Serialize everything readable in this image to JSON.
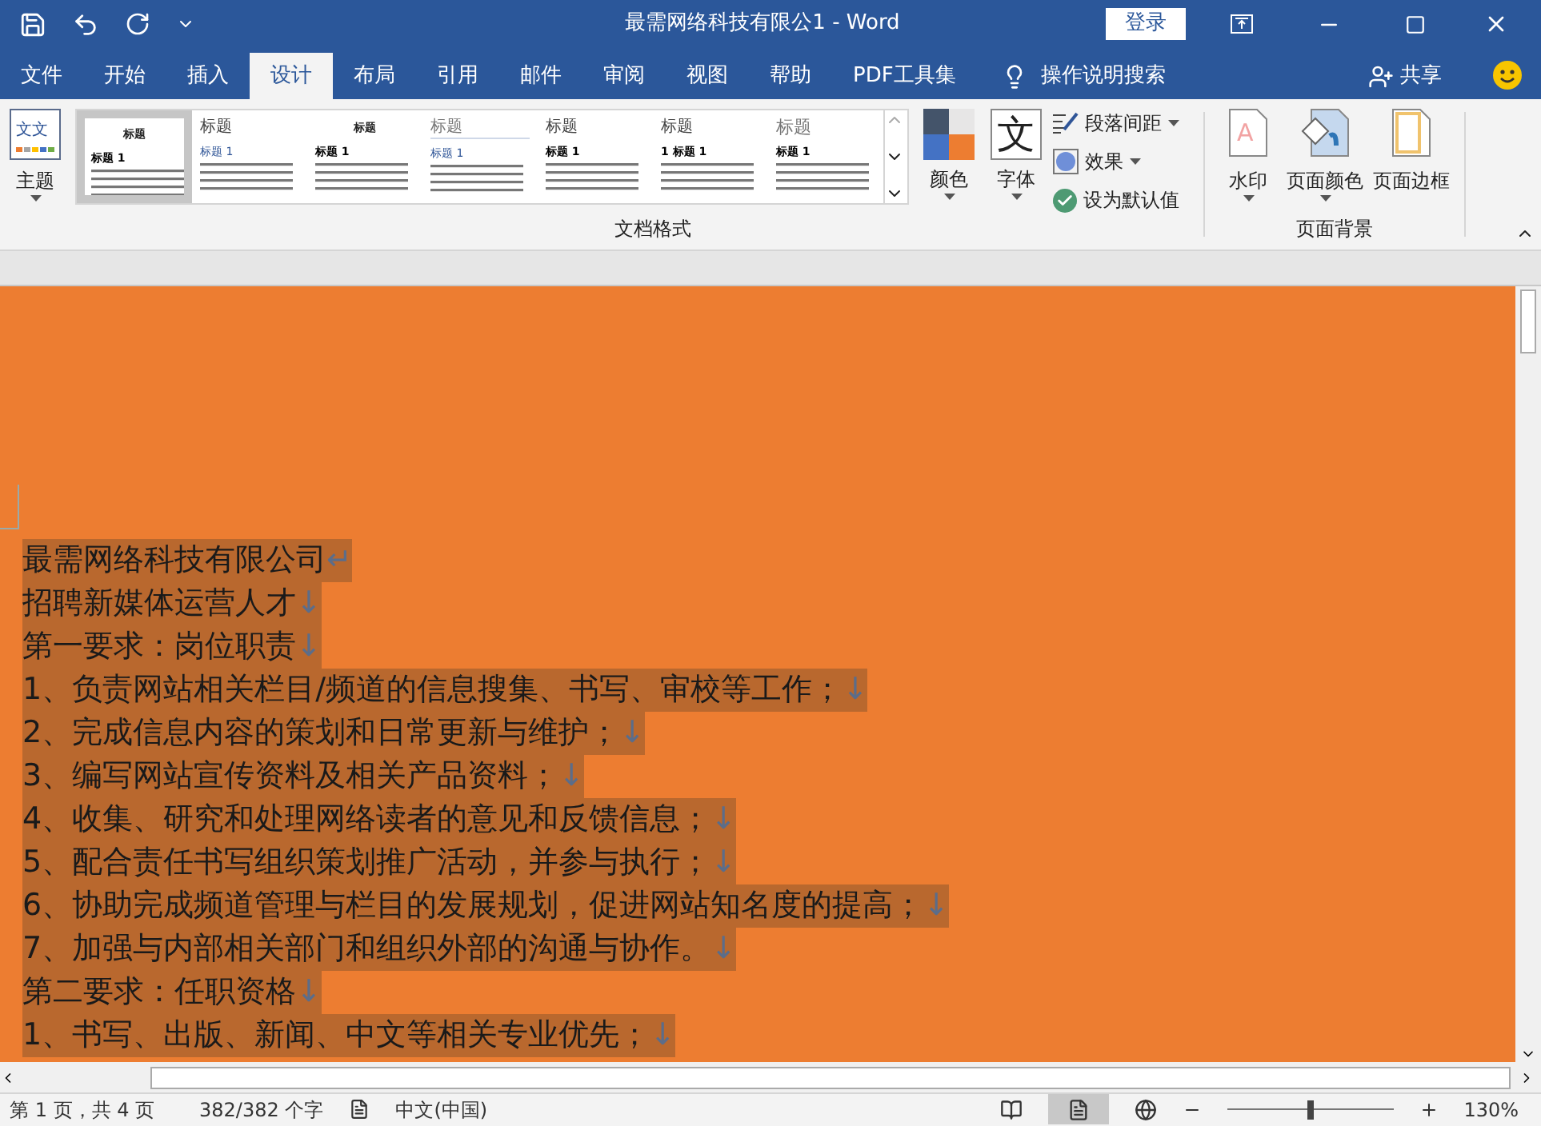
{
  "title_bar": {
    "title": "最需网络科技有限公1  -  Word",
    "login": "登录"
  },
  "tabs": [
    {
      "label": "文件",
      "selected": false
    },
    {
      "label": "开始",
      "selected": false
    },
    {
      "label": "插入",
      "selected": false
    },
    {
      "label": "设计",
      "selected": true
    },
    {
      "label": "布局",
      "selected": false
    },
    {
      "label": "引用",
      "selected": false
    },
    {
      "label": "邮件",
      "selected": false
    },
    {
      "label": "审阅",
      "selected": false
    },
    {
      "label": "视图",
      "selected": false
    },
    {
      "label": "帮助",
      "selected": false
    },
    {
      "label": "PDF工具集",
      "selected": false
    }
  ],
  "tell_me": "操作说明搜索",
  "share": "共享",
  "ribbon": {
    "theme": "主题",
    "theme_glyph": "文文",
    "watermark_glyph": "A",
    "gallery": [
      {
        "title": "标题",
        "heading": "标题 1",
        "selected": true,
        "kind": "centered"
      },
      {
        "title": "标题",
        "heading": "标题 1",
        "selected": false,
        "kind": "blue"
      },
      {
        "title": "标题",
        "heading": "标题 1",
        "selected": false,
        "kind": "centered"
      },
      {
        "title": "标题",
        "heading": "标题 1",
        "selected": false,
        "kind": "lined"
      },
      {
        "title": "标题",
        "heading": "标题 1",
        "selected": false,
        "kind": "plain"
      },
      {
        "title": "标题",
        "heading": "1  标题 1",
        "selected": false,
        "kind": "plain"
      },
      {
        "title": "标题",
        "heading": "标题 1",
        "selected": false,
        "kind": "grey"
      }
    ],
    "colors": "颜色",
    "fonts": "字体",
    "font_glyph": "文",
    "paragraph_spacing": "段落间距",
    "effects": "效果",
    "set_default": "设为默认值",
    "group_format": "文档格式",
    "watermark": "水印",
    "page_color": "页面颜色",
    "page_borders": "页面边框",
    "group_background": "页面背景"
  },
  "document": {
    "selected": true,
    "paragraphs": [
      {
        "text": "最需网络科技有限公司",
        "mark": "↵"
      },
      {
        "text": "招聘新媒体运营人才",
        "mark": "↓"
      },
      {
        "text": "第一要求：岗位职责",
        "mark": "↓"
      },
      {
        "text": "1、负责网站相关栏目/频道的信息搜集、书写、审校等工作；",
        "mark": "↓"
      },
      {
        "text": "2、完成信息内容的策划和日常更新与维护；",
        "mark": "↓"
      },
      {
        "text": "3、编写网站宣传资料及相关产品资料；",
        "mark": "↓"
      },
      {
        "text": "4、收集、研究和处理网络读者的意见和反馈信息；",
        "mark": "↓"
      },
      {
        "text": "5、配合责任书写组织策划推广活动，并参与执行；",
        "mark": "↓"
      },
      {
        "text": "6、协助完成频道管理与栏目的发展规划，促进网站知名度的提高；",
        "mark": "↓"
      },
      {
        "text": "7、加强与内部相关部门和组织外部的沟通与协作。",
        "mark": "↓"
      },
      {
        "text": "第二要求：任职资格",
        "mark": "↓"
      },
      {
        "text": "1、书写、出版、新闻、中文等相关专业优先；",
        "mark": "↓"
      }
    ]
  },
  "status_bar": {
    "page": "第 1 页，共 4 页",
    "words": "382/382 个字",
    "language": "中文(中国)",
    "zoom": "130%",
    "zoom_slider": {
      "level": 0.5
    }
  }
}
